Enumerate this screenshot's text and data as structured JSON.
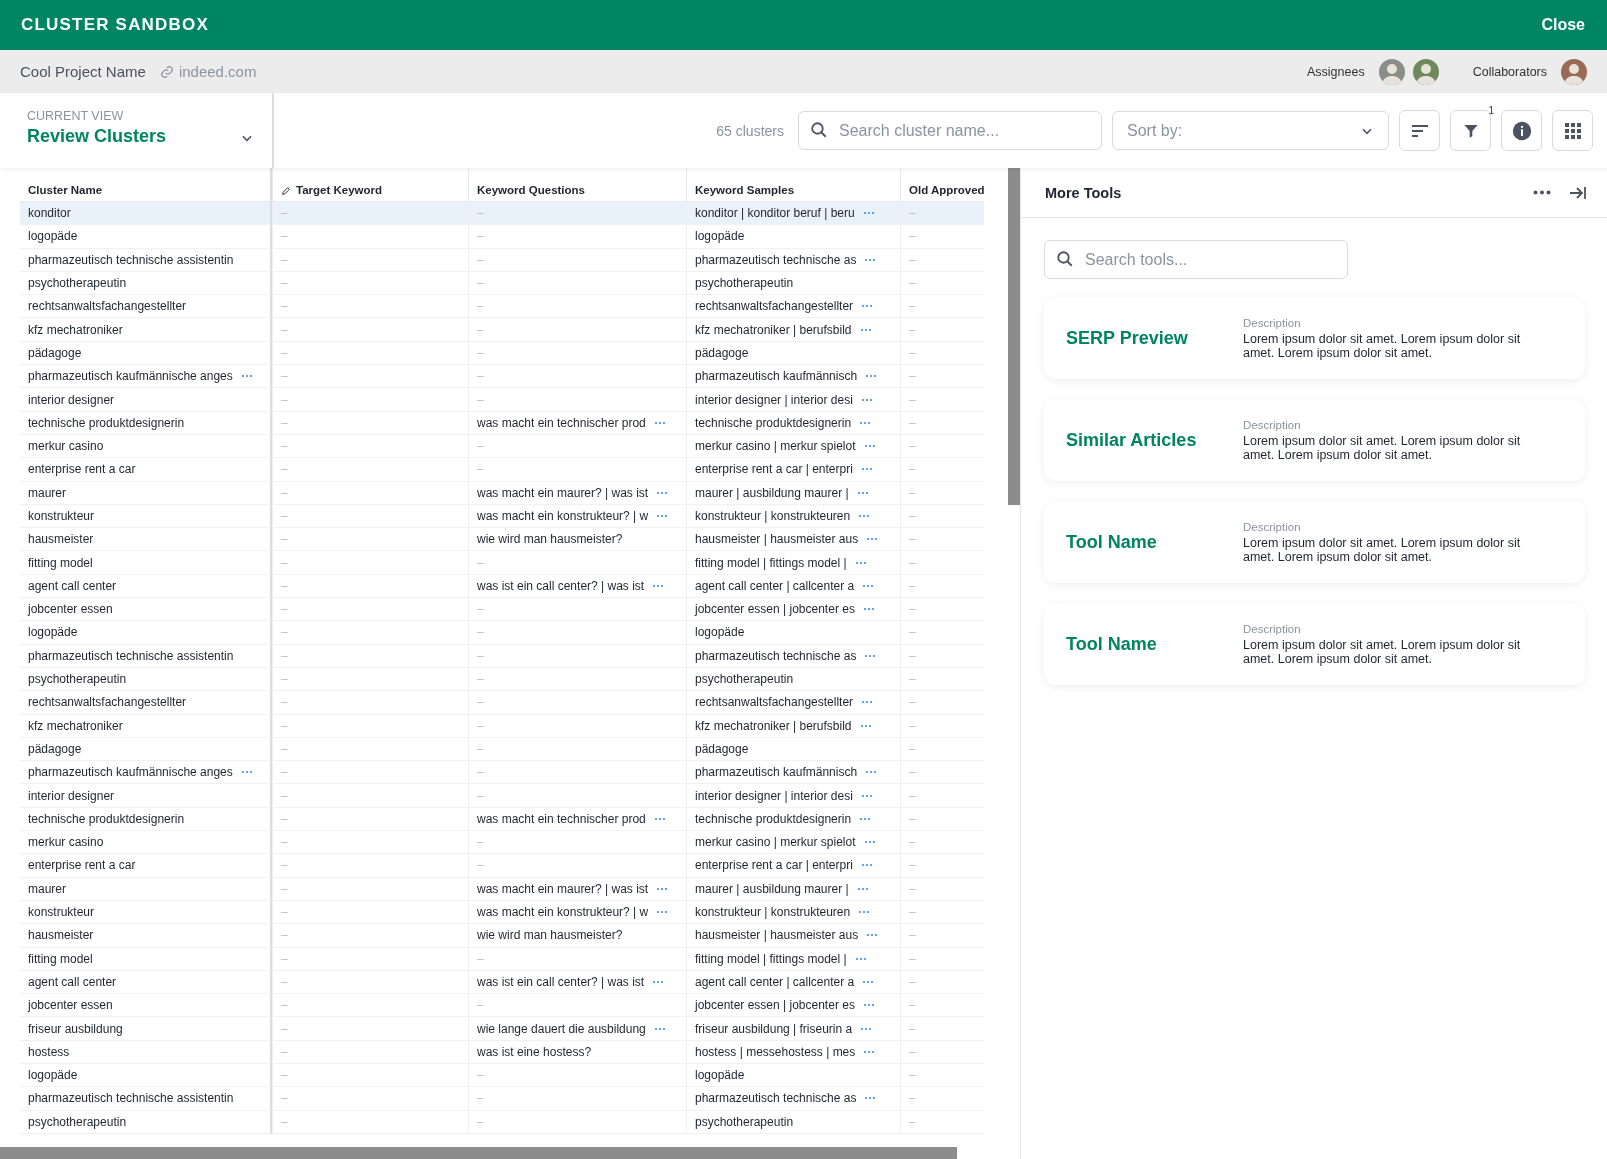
{
  "app_bar": {
    "title": "CLUSTER SANDBOX",
    "close": "Close"
  },
  "project_bar": {
    "project": "Cool Project Name",
    "link": "indeed.com",
    "assignees_label": "Assignees",
    "assignees": [
      {
        "color": "#8a8f88"
      },
      {
        "color": "#6e8a5a"
      }
    ],
    "collaborators_label": "Collaborators",
    "collaborators": [
      {
        "color": "#9a6a55"
      }
    ]
  },
  "toolbar": {
    "view_label": "CURRENT VIEW",
    "view": "Review Clusters",
    "count": "65 clusters",
    "search": {
      "placeholder": "Search cluster name..."
    },
    "sort": {
      "placeholder": "Sort by:"
    },
    "filter_badge": "1"
  },
  "table": {
    "columns": [
      {
        "label": "Cluster Name",
        "editable": false
      },
      {
        "label": "Target Keyword",
        "editable": true
      },
      {
        "label": "Keyword Questions",
        "editable": false
      },
      {
        "label": "Keyword Samples",
        "editable": false
      },
      {
        "label": "Old Approved",
        "editable": false
      }
    ],
    "rows": [
      {
        "selected": true,
        "cells": [
          {
            "text": "konditor"
          },
          {
            "text": "–",
            "muted": true
          },
          {
            "text": "–",
            "muted": true
          },
          {
            "text": "konditor | konditor beruf | beru",
            "more": true
          },
          {
            "text": "–",
            "muted": true
          }
        ]
      },
      {
        "selected": false,
        "cells": [
          {
            "text": "logopäde"
          },
          {
            "text": "–",
            "muted": true
          },
          {
            "text": "–",
            "muted": true
          },
          {
            "text": "logopäde"
          },
          {
            "text": "–",
            "muted": true
          }
        ]
      },
      {
        "selected": false,
        "cells": [
          {
            "text": "pharmazeutisch technische assistentin"
          },
          {
            "text": "–",
            "muted": true
          },
          {
            "text": "–",
            "muted": true
          },
          {
            "text": "pharmazeutisch technische as",
            "more": true
          },
          {
            "text": "–",
            "muted": true
          }
        ]
      },
      {
        "selected": false,
        "cells": [
          {
            "text": "psychotherapeutin"
          },
          {
            "text": "–",
            "muted": true
          },
          {
            "text": "–",
            "muted": true
          },
          {
            "text": "psychotherapeutin"
          },
          {
            "text": "–",
            "muted": true
          }
        ]
      },
      {
        "selected": false,
        "cells": [
          {
            "text": "rechtsanwaltsfachangestellter"
          },
          {
            "text": "–",
            "muted": true
          },
          {
            "text": "–",
            "muted": true
          },
          {
            "text": "rechtsanwaltsfachangestellter",
            "more": true
          },
          {
            "text": "–",
            "muted": true
          }
        ]
      },
      {
        "selected": false,
        "cells": [
          {
            "text": "kfz mechatroniker"
          },
          {
            "text": "–",
            "muted": true
          },
          {
            "text": "–",
            "muted": true
          },
          {
            "text": "kfz mechatroniker | berufsbild",
            "more": true
          },
          {
            "text": "–",
            "muted": true
          }
        ]
      },
      {
        "selected": false,
        "cells": [
          {
            "text": "pädagoge"
          },
          {
            "text": "–",
            "muted": true
          },
          {
            "text": "–",
            "muted": true
          },
          {
            "text": "pädagoge"
          },
          {
            "text": "–",
            "muted": true
          }
        ]
      },
      {
        "selected": false,
        "cells": [
          {
            "text": "pharmazeutisch kaufmännische anges",
            "more": true
          },
          {
            "text": "–",
            "muted": true
          },
          {
            "text": "–",
            "muted": true
          },
          {
            "text": "pharmazeutisch kaufmännisch",
            "more": true
          },
          {
            "text": "–",
            "muted": true
          }
        ]
      },
      {
        "selected": false,
        "cells": [
          {
            "text": "interior designer"
          },
          {
            "text": "–",
            "muted": true
          },
          {
            "text": "–",
            "muted": true
          },
          {
            "text": "interior designer | interior desi",
            "more": true
          },
          {
            "text": "–",
            "muted": true
          }
        ]
      },
      {
        "selected": false,
        "cells": [
          {
            "text": "technische produktdesignerin"
          },
          {
            "text": "–",
            "muted": true
          },
          {
            "text": "was macht ein technischer prod",
            "more": true
          },
          {
            "text": "technische produktdesignerin",
            "more": true
          },
          {
            "text": "–",
            "muted": true
          }
        ]
      },
      {
        "selected": false,
        "cells": [
          {
            "text": "merkur casino"
          },
          {
            "text": "–",
            "muted": true
          },
          {
            "text": "–",
            "muted": true
          },
          {
            "text": "merkur casino | merkur spielot",
            "more": true
          },
          {
            "text": "–",
            "muted": true
          }
        ]
      },
      {
        "selected": false,
        "cells": [
          {
            "text": "enterprise rent a car"
          },
          {
            "text": "–",
            "muted": true
          },
          {
            "text": "–",
            "muted": true
          },
          {
            "text": "enterprise rent a car | enterpri",
            "more": true
          },
          {
            "text": "–",
            "muted": true
          }
        ]
      },
      {
        "selected": false,
        "cells": [
          {
            "text": "maurer"
          },
          {
            "text": "–",
            "muted": true
          },
          {
            "text": "was macht ein maurer? | was ist",
            "more": true
          },
          {
            "text": "maurer | ausbildung maurer |",
            "more": true
          },
          {
            "text": "–",
            "muted": true
          }
        ]
      },
      {
        "selected": false,
        "cells": [
          {
            "text": "konstrukteur"
          },
          {
            "text": "–",
            "muted": true
          },
          {
            "text": "was macht ein konstrukteur? | w",
            "more": true
          },
          {
            "text": "konstrukteur | konstrukteuren",
            "more": true
          },
          {
            "text": "–",
            "muted": true
          }
        ]
      },
      {
        "selected": false,
        "cells": [
          {
            "text": "hausmeister"
          },
          {
            "text": "–",
            "muted": true
          },
          {
            "text": "wie wird man hausmeister?"
          },
          {
            "text": "hausmeister | hausmeister aus",
            "more": true
          },
          {
            "text": "–",
            "muted": true
          }
        ]
      },
      {
        "selected": false,
        "cells": [
          {
            "text": "fitting model"
          },
          {
            "text": "–",
            "muted": true
          },
          {
            "text": "–",
            "muted": true
          },
          {
            "text": "fitting model | fittings model |",
            "more": true
          },
          {
            "text": "–",
            "muted": true
          }
        ]
      },
      {
        "selected": false,
        "cells": [
          {
            "text": "agent call center"
          },
          {
            "text": "–",
            "muted": true
          },
          {
            "text": "was ist ein call center? | was ist",
            "more": true
          },
          {
            "text": "agent call center | callcenter a",
            "more": true
          },
          {
            "text": "–",
            "muted": true
          }
        ]
      },
      {
        "selected": false,
        "cells": [
          {
            "text": "jobcenter essen"
          },
          {
            "text": "–",
            "muted": true
          },
          {
            "text": "–",
            "muted": true
          },
          {
            "text": "jobcenter essen | jobcenter es",
            "more": true
          },
          {
            "text": "–",
            "muted": true
          }
        ]
      },
      {
        "selected": false,
        "cells": [
          {
            "text": "logopäde"
          },
          {
            "text": "–",
            "muted": true
          },
          {
            "text": "–",
            "muted": true
          },
          {
            "text": "logopäde"
          },
          {
            "text": "–",
            "muted": true
          }
        ]
      },
      {
        "selected": false,
        "cells": [
          {
            "text": "pharmazeutisch technische assistentin"
          },
          {
            "text": "–",
            "muted": true
          },
          {
            "text": "–",
            "muted": true
          },
          {
            "text": "pharmazeutisch technische as",
            "more": true
          },
          {
            "text": "–",
            "muted": true
          }
        ]
      },
      {
        "selected": false,
        "cells": [
          {
            "text": "psychotherapeutin"
          },
          {
            "text": "–",
            "muted": true
          },
          {
            "text": "–",
            "muted": true
          },
          {
            "text": "psychotherapeutin"
          },
          {
            "text": "–",
            "muted": true
          }
        ]
      },
      {
        "selected": false,
        "cells": [
          {
            "text": "rechtsanwaltsfachangestellter"
          },
          {
            "text": "–",
            "muted": true
          },
          {
            "text": "–",
            "muted": true
          },
          {
            "text": "rechtsanwaltsfachangestellter",
            "more": true
          },
          {
            "text": "–",
            "muted": true
          }
        ]
      },
      {
        "selected": false,
        "cells": [
          {
            "text": "kfz mechatroniker"
          },
          {
            "text": "–",
            "muted": true
          },
          {
            "text": "–",
            "muted": true
          },
          {
            "text": "kfz mechatroniker | berufsbild",
            "more": true
          },
          {
            "text": "–",
            "muted": true
          }
        ]
      },
      {
        "selected": false,
        "cells": [
          {
            "text": "pädagoge"
          },
          {
            "text": "–",
            "muted": true
          },
          {
            "text": "–",
            "muted": true
          },
          {
            "text": "pädagoge"
          },
          {
            "text": "–",
            "muted": true
          }
        ]
      },
      {
        "selected": false,
        "cells": [
          {
            "text": "pharmazeutisch kaufmännische anges",
            "more": true
          },
          {
            "text": "–",
            "muted": true
          },
          {
            "text": "–",
            "muted": true
          },
          {
            "text": "pharmazeutisch kaufmännisch",
            "more": true
          },
          {
            "text": "–",
            "muted": true
          }
        ]
      },
      {
        "selected": false,
        "cells": [
          {
            "text": "interior designer"
          },
          {
            "text": "–",
            "muted": true
          },
          {
            "text": "–",
            "muted": true
          },
          {
            "text": "interior designer | interior desi",
            "more": true
          },
          {
            "text": "–",
            "muted": true
          }
        ]
      },
      {
        "selected": false,
        "cells": [
          {
            "text": "technische produktdesignerin"
          },
          {
            "text": "–",
            "muted": true
          },
          {
            "text": "was macht ein technischer prod",
            "more": true
          },
          {
            "text": "technische produktdesignerin",
            "more": true
          },
          {
            "text": "–",
            "muted": true
          }
        ]
      },
      {
        "selected": false,
        "cells": [
          {
            "text": "merkur casino"
          },
          {
            "text": "–",
            "muted": true
          },
          {
            "text": "–",
            "muted": true
          },
          {
            "text": "merkur casino | merkur spielot",
            "more": true
          },
          {
            "text": "–",
            "muted": true
          }
        ]
      },
      {
        "selected": false,
        "cells": [
          {
            "text": "enterprise rent a car"
          },
          {
            "text": "–",
            "muted": true
          },
          {
            "text": "–",
            "muted": true
          },
          {
            "text": "enterprise rent a car | enterpri",
            "more": true
          },
          {
            "text": "–",
            "muted": true
          }
        ]
      },
      {
        "selected": false,
        "cells": [
          {
            "text": "maurer"
          },
          {
            "text": "–",
            "muted": true
          },
          {
            "text": "was macht ein maurer? | was ist",
            "more": true
          },
          {
            "text": "maurer | ausbildung maurer |",
            "more": true
          },
          {
            "text": "–",
            "muted": true
          }
        ]
      },
      {
        "selected": false,
        "cells": [
          {
            "text": "konstrukteur"
          },
          {
            "text": "–",
            "muted": true
          },
          {
            "text": "was macht ein konstrukteur? | w",
            "more": true
          },
          {
            "text": "konstrukteur | konstrukteuren",
            "more": true
          },
          {
            "text": "–",
            "muted": true
          }
        ]
      },
      {
        "selected": false,
        "cells": [
          {
            "text": "hausmeister"
          },
          {
            "text": "–",
            "muted": true
          },
          {
            "text": "wie wird man hausmeister?"
          },
          {
            "text": "hausmeister | hausmeister aus",
            "more": true
          },
          {
            "text": "–",
            "muted": true
          }
        ]
      },
      {
        "selected": false,
        "cells": [
          {
            "text": "fitting model"
          },
          {
            "text": "–",
            "muted": true
          },
          {
            "text": "–",
            "muted": true
          },
          {
            "text": "fitting model | fittings model |",
            "more": true
          },
          {
            "text": "–",
            "muted": true
          }
        ]
      },
      {
        "selected": false,
        "cells": [
          {
            "text": "agent call center"
          },
          {
            "text": "–",
            "muted": true
          },
          {
            "text": "was ist ein call center? | was ist",
            "more": true
          },
          {
            "text": "agent call center | callcenter a",
            "more": true
          },
          {
            "text": "–",
            "muted": true
          }
        ]
      },
      {
        "selected": false,
        "cells": [
          {
            "text": "jobcenter essen"
          },
          {
            "text": "–",
            "muted": true
          },
          {
            "text": "–",
            "muted": true
          },
          {
            "text": "jobcenter essen | jobcenter es",
            "more": true
          },
          {
            "text": "–",
            "muted": true
          }
        ]
      },
      {
        "selected": false,
        "cells": [
          {
            "text": "friseur ausbildung"
          },
          {
            "text": "–",
            "muted": true
          },
          {
            "text": "wie lange dauert die ausbildung",
            "more": true
          },
          {
            "text": "friseur ausbildung | friseurin a",
            "more": true
          },
          {
            "text": "–",
            "muted": true
          }
        ]
      },
      {
        "selected": false,
        "cells": [
          {
            "text": "hostess"
          },
          {
            "text": "–",
            "muted": true
          },
          {
            "text": "was ist eine hostess?"
          },
          {
            "text": "hostess | messehostess | mes",
            "more": true
          },
          {
            "text": "–",
            "muted": true
          }
        ]
      },
      {
        "selected": false,
        "cells": [
          {
            "text": "logopäde"
          },
          {
            "text": "–",
            "muted": true
          },
          {
            "text": "–",
            "muted": true
          },
          {
            "text": "logopäde"
          },
          {
            "text": "–",
            "muted": true
          }
        ]
      },
      {
        "selected": false,
        "cells": [
          {
            "text": "pharmazeutisch technische assistentin"
          },
          {
            "text": "–",
            "muted": true
          },
          {
            "text": "–",
            "muted": true
          },
          {
            "text": "pharmazeutisch technische as",
            "more": true
          },
          {
            "text": "–",
            "muted": true
          }
        ]
      },
      {
        "selected": false,
        "cells": [
          {
            "text": "psychotherapeutin"
          },
          {
            "text": "–",
            "muted": true
          },
          {
            "text": "–",
            "muted": true
          },
          {
            "text": "psychotherapeutin"
          },
          {
            "text": "–",
            "muted": true
          }
        ]
      }
    ]
  },
  "tools_panel": {
    "title": "More Tools",
    "search": {
      "placeholder": "Search tools..."
    },
    "tools": [
      {
        "name": "SERP Preview",
        "description_label": "Description",
        "description": "Lorem ipsum dolor sit amet. Lorem ipsum dolor sit amet. Lorem ipsum dolor sit amet."
      },
      {
        "name": "Similar Articles",
        "description_label": "Description",
        "description": "Lorem ipsum dolor sit amet. Lorem ipsum dolor sit amet. Lorem ipsum dolor sit amet."
      },
      {
        "name": "Tool Name",
        "description_label": "Description",
        "description": "Lorem ipsum dolor sit amet. Lorem ipsum dolor sit amet. Lorem ipsum dolor sit amet."
      },
      {
        "name": "Tool Name",
        "description_label": "Description",
        "description": "Lorem ipsum dolor sit amet. Lorem ipsum dolor sit amet. Lorem ipsum dolor sit amet."
      }
    ]
  }
}
